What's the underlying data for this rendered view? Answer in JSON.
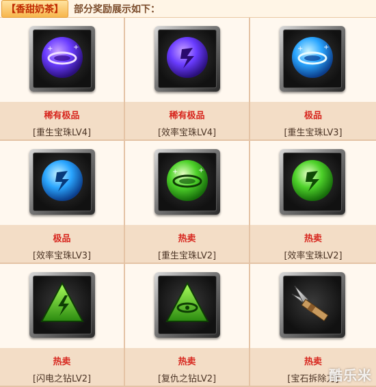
{
  "header": {
    "brand": "【香甜奶茶】",
    "text": "部分奖励展示如下："
  },
  "rewards": [
    {
      "tag": "稀有极品",
      "name": "[重生宝珠LV4]",
      "icon": "purple-orb-ring-icon"
    },
    {
      "tag": "稀有极品",
      "name": "[效率宝珠LV4]",
      "icon": "purple-orb-swirl-icon"
    },
    {
      "tag": "极品",
      "name": "[重生宝珠LV3]",
      "icon": "blue-orb-ring-icon"
    },
    {
      "tag": "极品",
      "name": "[效率宝珠LV3]",
      "icon": "blue-orb-swirl-icon"
    },
    {
      "tag": "热卖",
      "name": "[重生宝珠LV2]",
      "icon": "green-orb-ring-icon"
    },
    {
      "tag": "热卖",
      "name": "[效率宝珠LV2]",
      "icon": "green-orb-swirl-icon"
    },
    {
      "tag": "热卖",
      "name": "[闪电之钻LV2]",
      "icon": "lightning-triangle-icon"
    },
    {
      "tag": "热卖",
      "name": "[复仇之钻LV2]",
      "icon": "eye-triangle-icon"
    },
    {
      "tag": "热卖",
      "name": "[宝石拆除刀]",
      "icon": "gem-removal-knife-icon"
    }
  ],
  "watermark": "酷乐米",
  "colors": {
    "tag": "#d7261e",
    "caption_bg": "#f3ddc6",
    "purple": "#6a3cff",
    "blue": "#2aa6ff",
    "green": "#4ed22a"
  }
}
